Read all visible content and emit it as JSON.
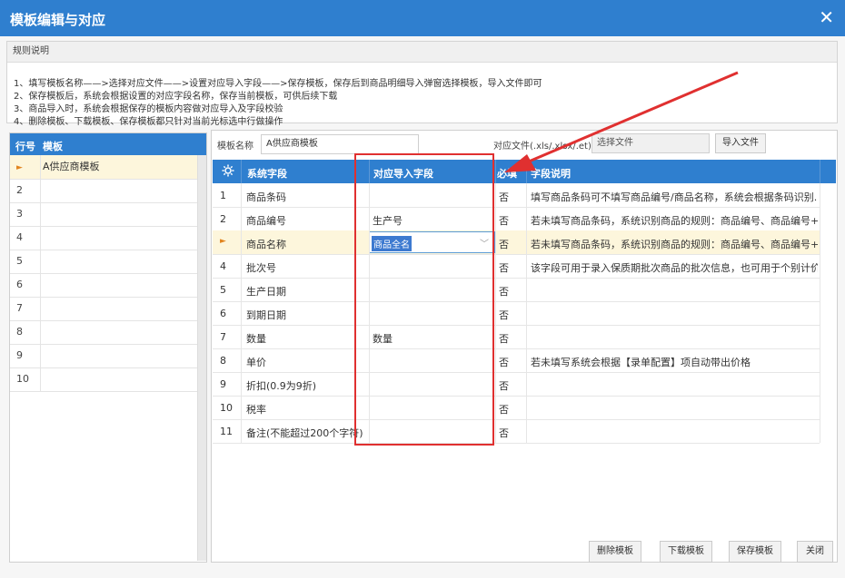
{
  "dialog": {
    "title": "模板编辑与对应",
    "close_glyph": "✕"
  },
  "rules": {
    "header": "规则说明",
    "lines": [
      "1、填写模板名称——>选择对应文件——>设置对应导入字段——>保存模板，保存后到商品明细导入弹窗选择模板，导入文件即可",
      "2、保存模板后，系统会根据设置的对应字段名称，保存当前模板，可供后续下载",
      "3、商品导入时，系统会根据保存的模板内容做对应导入及字段校验",
      "4、删除模板、下载模板、保存模板都只针对当前光标选中行做操作"
    ]
  },
  "template_list": {
    "headers": [
      "行号",
      "模板"
    ],
    "rows": [
      {
        "num": "",
        "name": "A供应商模板",
        "selected": true
      },
      {
        "num": "2",
        "name": ""
      },
      {
        "num": "3",
        "name": ""
      },
      {
        "num": "4",
        "name": ""
      },
      {
        "num": "5",
        "name": ""
      },
      {
        "num": "6",
        "name": ""
      },
      {
        "num": "7",
        "name": ""
      },
      {
        "num": "8",
        "name": ""
      },
      {
        "num": "9",
        "name": ""
      },
      {
        "num": "10",
        "name": ""
      }
    ],
    "selected_marker": "►"
  },
  "form": {
    "template_name_label": "模板名称",
    "template_name_value": "A供应商模板",
    "file_label": "对应文件(.xls/.xlsx/.et)",
    "file_value": "选择文件",
    "import_button": "导入文件"
  },
  "grid": {
    "headers": {
      "system_field": "系统字段",
      "import_field": "对应导入字段",
      "required": "必填",
      "desc": "字段说明"
    },
    "rows": [
      {
        "num": "1",
        "field": "商品条码",
        "import": "",
        "required": "否",
        "desc": "填写商品条码可不填写商品编号/商品名称，系统会根据条码识别..."
      },
      {
        "num": "2",
        "field": "商品编号",
        "import": "生产号",
        "required": "否",
        "desc": "若未填写商品条码，系统识别商品的规则：商品编号、商品编号+..."
      },
      {
        "num": "",
        "field": "商品名称",
        "import": "商品全名",
        "required": "否",
        "desc": "若未填写商品条码，系统识别商品的规则：商品编号、商品编号+...",
        "selected": true
      },
      {
        "num": "4",
        "field": "批次号",
        "import": "",
        "required": "否",
        "desc": "该字段可用于录入保质期批次商品的批次信息，也可用于个别计价..."
      },
      {
        "num": "5",
        "field": "生产日期",
        "import": "",
        "required": "否",
        "desc": ""
      },
      {
        "num": "6",
        "field": "到期日期",
        "import": "",
        "required": "否",
        "desc": ""
      },
      {
        "num": "7",
        "field": "数量",
        "import": "数量",
        "required": "否",
        "desc": ""
      },
      {
        "num": "8",
        "field": "单价",
        "import": "",
        "required": "否",
        "desc": "若未填写系统会根据【录单配置】项自动带出价格"
      },
      {
        "num": "9",
        "field": "折扣(0.9为9折)",
        "import": "",
        "required": "否",
        "desc": ""
      },
      {
        "num": "10",
        "field": "税率",
        "import": "",
        "required": "否",
        "desc": ""
      },
      {
        "num": "11",
        "field": "备注(不能超过200个字符)",
        "import": "",
        "required": "否",
        "desc": ""
      }
    ],
    "dropdown_chevron": "﹀"
  },
  "footer": {
    "delete": "删除模板",
    "download": "下载模板",
    "save": "保存模板",
    "close": "关闭"
  },
  "colors": {
    "accent": "#2f7fcf",
    "highlight": "#e03030",
    "selected_row": "#fdf6dc"
  }
}
